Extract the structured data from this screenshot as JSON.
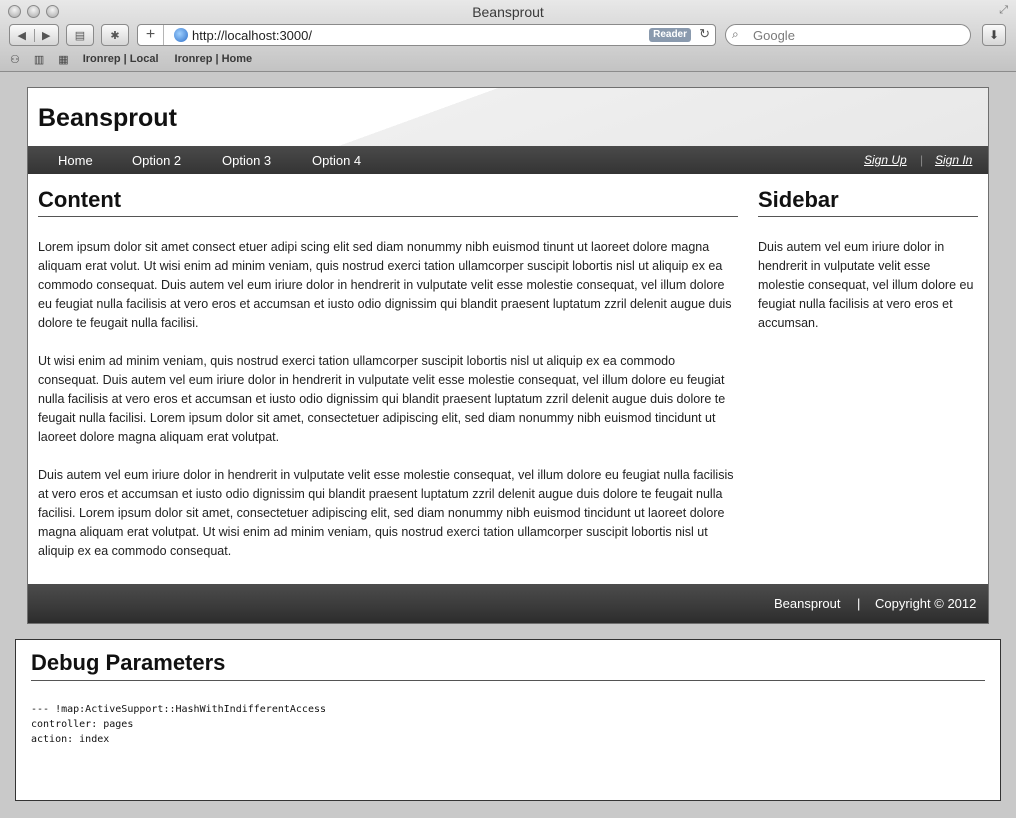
{
  "window": {
    "title": "Beansprout"
  },
  "toolbar": {
    "back_icon": "◀",
    "forward_icon": "▶",
    "topsites_icon": "▤",
    "bug_icon": "✱",
    "add_icon": "+",
    "url": "http://localhost:3000/",
    "reader_label": "Reader",
    "reload_icon": "↻",
    "search_placeholder": "Google",
    "search_icon": "⌕",
    "download_icon": "⬇"
  },
  "bookmarks": {
    "items": [
      {
        "label": "Ironrep | Local"
      },
      {
        "label": "Ironrep | Home"
      }
    ]
  },
  "site": {
    "title": "Beansprout",
    "nav": [
      {
        "label": "Home"
      },
      {
        "label": "Option 2"
      },
      {
        "label": "Option 3"
      },
      {
        "label": "Option 4"
      }
    ],
    "auth": {
      "signup": "Sign Up",
      "separator": "|",
      "signin": "Sign In"
    }
  },
  "content": {
    "heading": "Content",
    "paragraphs": [
      "Lorem ipsum dolor sit amet consect etuer adipi scing elit sed diam nonummy nibh euismod tinunt ut laoreet dolore magna aliquam erat volut. Ut wisi enim ad minim veniam, quis nostrud exerci tation ullamcorper suscipit lobortis nisl ut aliquip ex ea commodo consequat. Duis autem vel eum iriure dolor in hendrerit in vulputate velit esse molestie consequat, vel illum dolore eu feugiat nulla facilisis at vero eros et accumsan et iusto odio dignissim qui blandit praesent luptatum zzril delenit augue duis dolore te feugait nulla facilisi.",
      "Ut wisi enim ad minim veniam, quis nostrud exerci tation ullamcorper suscipit lobortis nisl ut aliquip ex ea commodo consequat. Duis autem vel eum iriure dolor in hendrerit in vulputate velit esse molestie consequat, vel illum dolore eu feugiat nulla facilisis at vero eros et accumsan et iusto odio dignissim qui blandit praesent luptatum zzril delenit augue duis dolore te feugait nulla facilisi. Lorem ipsum dolor sit amet, consectetuer adipiscing elit, sed diam nonummy nibh euismod tincidunt ut laoreet dolore magna aliquam erat volutpat.",
      "Duis autem vel eum iriure dolor in hendrerit in vulputate velit esse molestie consequat, vel illum dolore eu feugiat nulla facilisis at vero eros et accumsan et iusto odio dignissim qui blandit praesent luptatum zzril delenit augue duis dolore te feugait nulla facilisi. Lorem ipsum dolor sit amet, consectetuer adipiscing elit, sed diam nonummy nibh euismod tincidunt ut laoreet dolore magna aliquam erat volutpat. Ut wisi enim ad minim veniam, quis nostrud exerci tation ullamcorper suscipit lobortis nisl ut aliquip ex ea commodo consequat."
    ]
  },
  "sidebar": {
    "heading": "Sidebar",
    "text": "Duis autem vel eum iriure dolor in hendrerit in vulputate velit esse molestie consequat, vel illum dolore eu feugiat nulla facilisis at vero eros et accumsan."
  },
  "footer": {
    "brand": "Beansprout",
    "separator": "|",
    "copyright": "Copyright © 2012"
  },
  "debug": {
    "heading": "Debug Parameters",
    "lines": [
      "--- !map:ActiveSupport::HashWithIndifferentAccess",
      "controller: pages",
      "action: index"
    ]
  }
}
